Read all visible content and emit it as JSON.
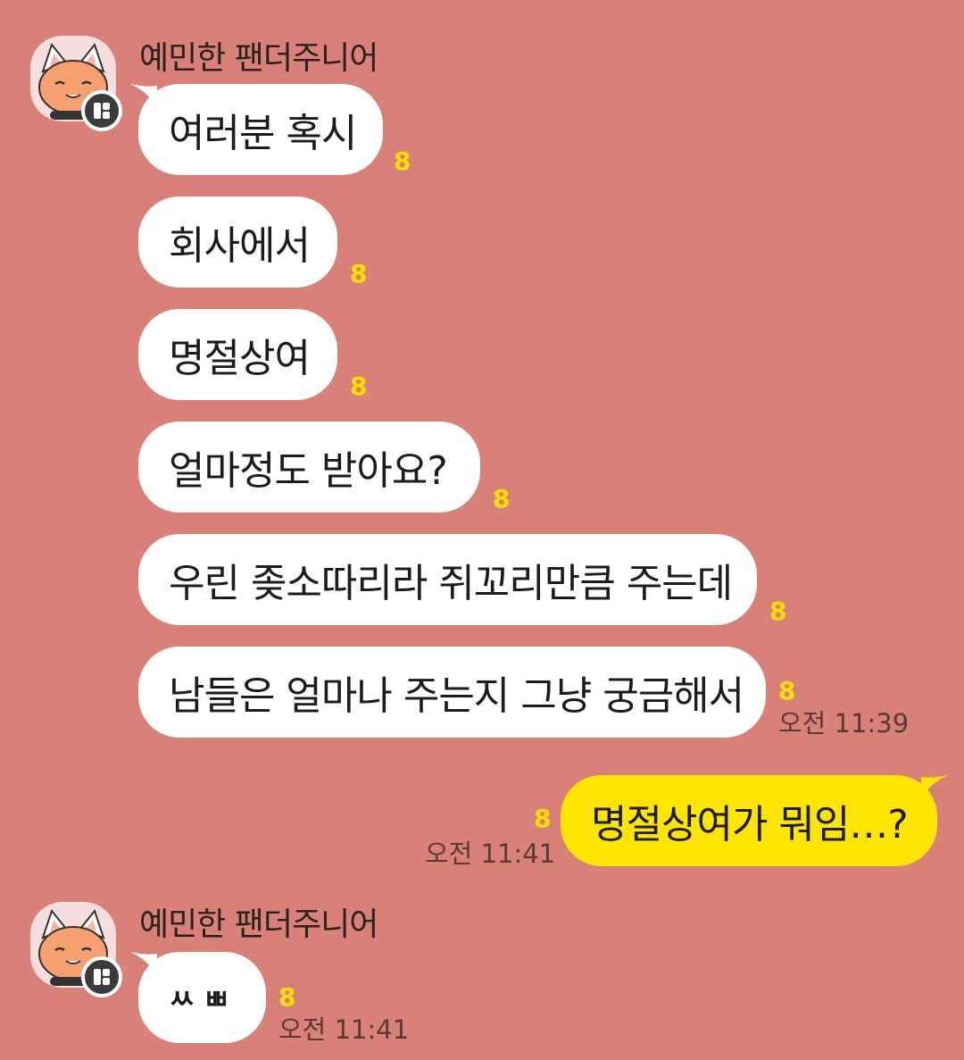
{
  "conversation": {
    "groups": [
      {
        "sender": "예민한 팬더주니어",
        "messages": [
          {
            "text": "여러분 혹시",
            "unread": "8"
          },
          {
            "text": "회사에서",
            "unread": "8"
          },
          {
            "text": "명절상여",
            "unread": "8"
          },
          {
            "text": "얼마정도 받아요?",
            "unread": "8"
          },
          {
            "text": "우린 좆소따리라 쥐꼬리만큼 주는데",
            "unread": "8"
          },
          {
            "text": "남들은 얼마나 주는지 그냥 궁금해서",
            "unread": "8",
            "time": "오전 11:39"
          }
        ]
      },
      {
        "sender": "me",
        "messages": [
          {
            "text": "명절상여가 뭐임…?",
            "unread": "8",
            "time": "오전 11:41"
          }
        ]
      },
      {
        "sender": "예민한 팬더주니어",
        "messages": [
          {
            "text": "ㅆ ㅃ",
            "unread": "8",
            "time": "오전 11:41"
          }
        ]
      }
    ]
  },
  "colors": {
    "background": "#d98078",
    "incoming_bubble": "#ffffff",
    "outgoing_bubble": "#fee500",
    "unread_count": "#ffe000"
  },
  "icons": {
    "avatar": "cat-character-avatar-icon",
    "badge": "profile-badge-icon"
  }
}
